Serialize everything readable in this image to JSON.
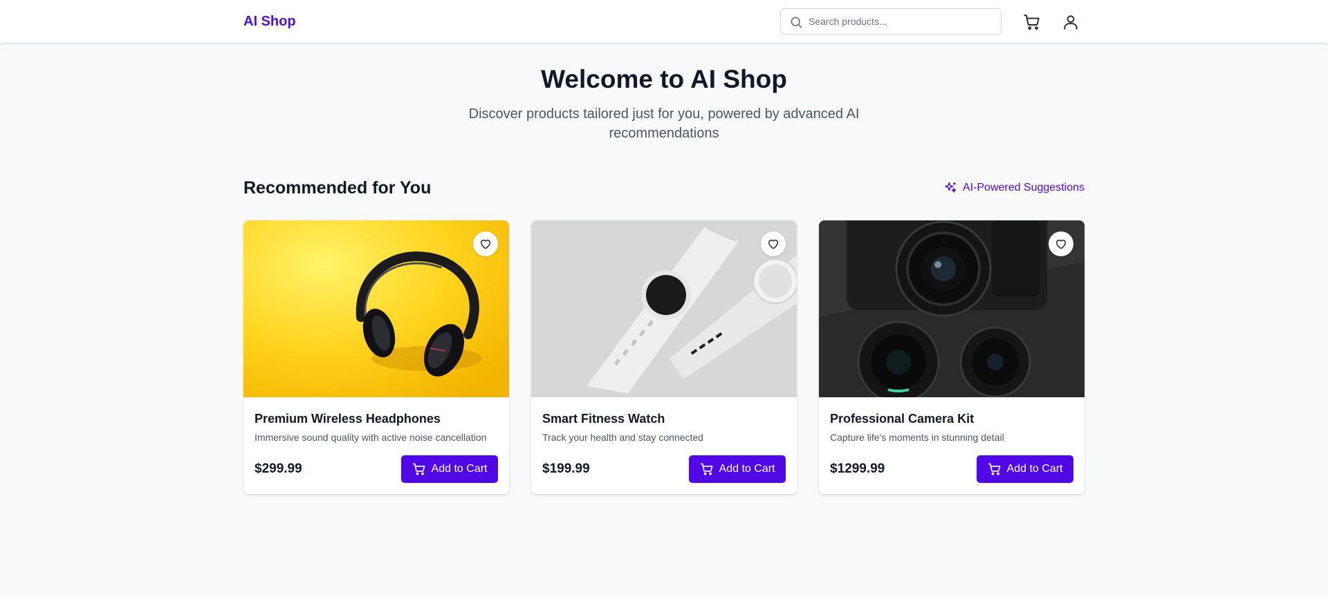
{
  "brand": {
    "name": "AI Shop",
    "accent_color": "#4f0ee0"
  },
  "header": {
    "search_placeholder": "Search products...",
    "search_value": "",
    "icons": [
      "search-icon",
      "cart-icon",
      "user-icon"
    ]
  },
  "hero": {
    "title": "Welcome to AI Shop",
    "subtitle": "Discover products tailored just for you, powered by advanced AI recommendations"
  },
  "recommendations": {
    "title": "Recommended for You",
    "tag_label": "AI-Powered Suggestions",
    "tag_icon": "sparkles-icon"
  },
  "products": [
    {
      "name": "Premium Wireless Headphones",
      "description": "Immersive sound quality with active noise cancellation",
      "price": "$299.99",
      "button_label": "Add to Cart",
      "image": "headphones-photo"
    },
    {
      "name": "Smart Fitness Watch",
      "description": "Track your health and stay connected",
      "price": "$199.99",
      "button_label": "Add to Cart",
      "image": "smartwatch-photo"
    },
    {
      "name": "Professional Camera Kit",
      "description": "Capture life's moments in stunning detail",
      "price": "$1299.99",
      "button_label": "Add to Cart",
      "image": "camera-photo"
    }
  ],
  "colors": {
    "button_bg": "#5108e6",
    "page_bg": "#f8f9fb"
  }
}
